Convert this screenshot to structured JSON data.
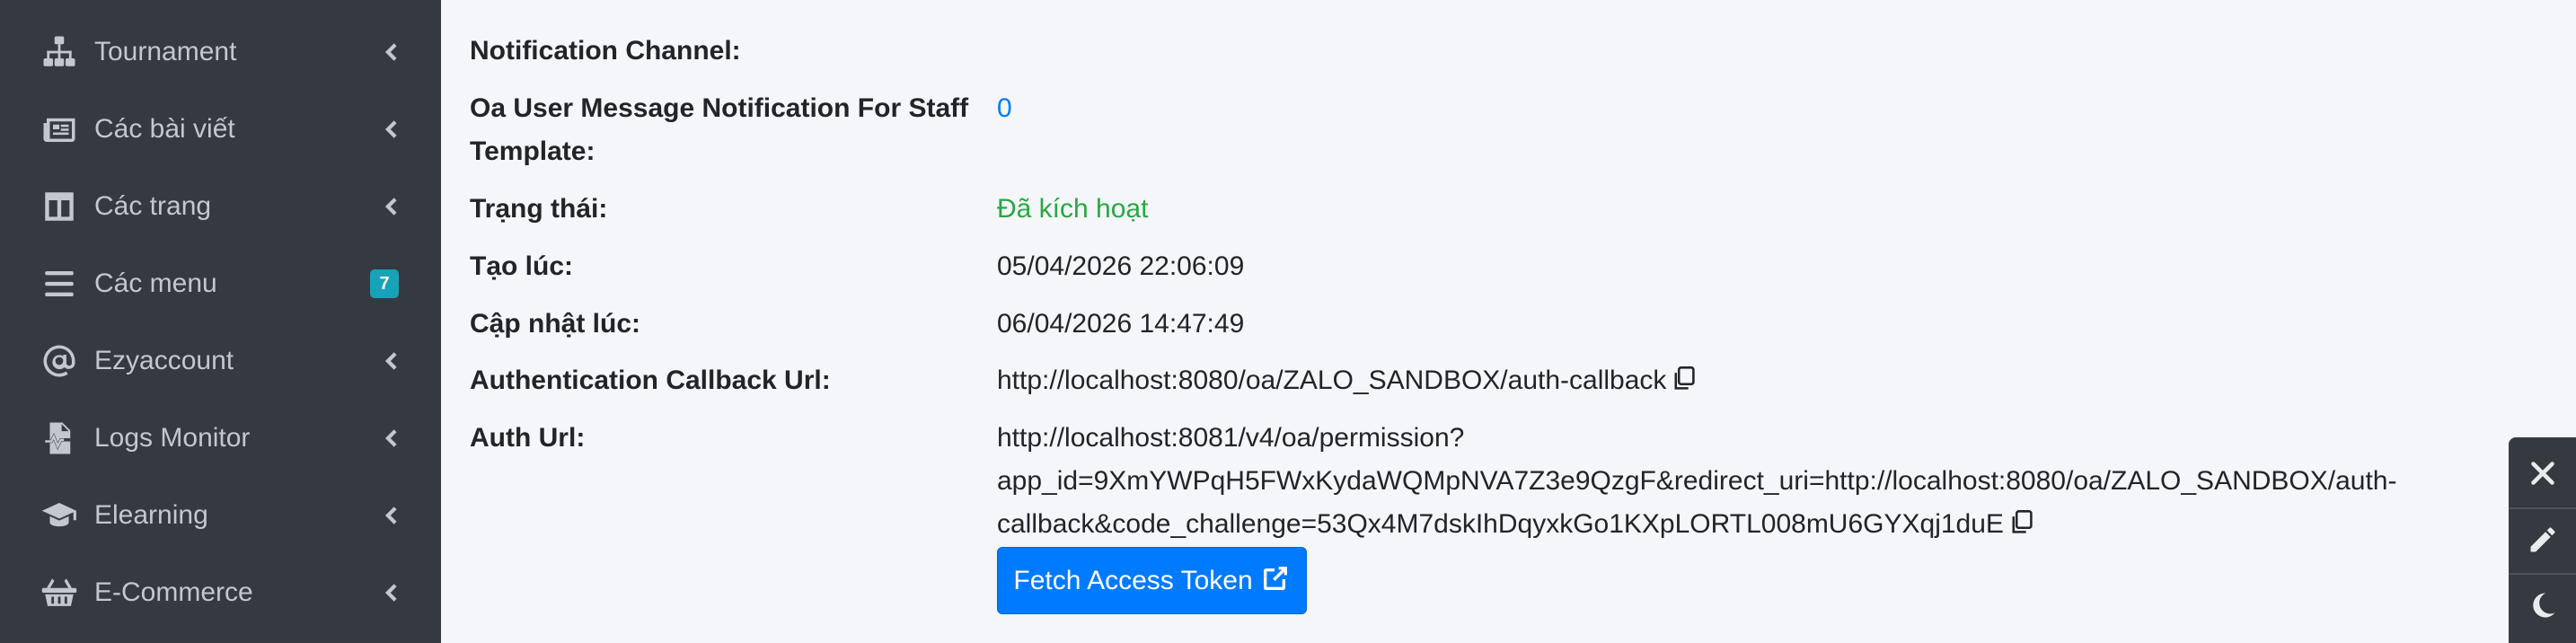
{
  "sidebar": {
    "items": [
      {
        "label": "Tournament",
        "icon": "sitemap-icon"
      },
      {
        "label": "Các bài viết",
        "icon": "newspaper-icon"
      },
      {
        "label": "Các trang",
        "icon": "columns-icon"
      },
      {
        "label": "Các menu",
        "icon": "bars-icon",
        "badge": "7"
      },
      {
        "label": "Ezyaccount",
        "icon": "at-icon"
      },
      {
        "label": "Logs Monitor",
        "icon": "file-medical-alt-icon"
      },
      {
        "label": "Elearning",
        "icon": "graduation-cap-icon"
      },
      {
        "label": "E-Commerce",
        "icon": "shopping-basket-icon"
      }
    ]
  },
  "details": {
    "notification_channel": {
      "label": "Notification Channel:",
      "value": ""
    },
    "oa_template": {
      "label_line1": "Oa User Message Notification For Staff",
      "label_line2": "Template:",
      "value": "0"
    },
    "status": {
      "label": "Trạng thái:",
      "value": "Đã kích hoạt"
    },
    "created_at": {
      "label": "Tạo lúc:",
      "value": "05/04/2026 22:06:09"
    },
    "updated_at": {
      "label": "Cập nhật lúc:",
      "value": "06/04/2026 14:47:49"
    },
    "callback_url": {
      "label": "Authentication Callback Url:",
      "value": "http://localhost:8080/oa/ZALO_SANDBOX/auth-callback"
    },
    "auth_url": {
      "label": "Auth Url:",
      "line1": "http://localhost:8081/v4/oa/permission?",
      "line2": "app_id=9XmYWPqH5FWxKydaWQMpNVA7Z3e9QzgF&redirect_uri=http://localhost:8080/oa/ZALO_SANDBOX/auth-",
      "line3": "callback&code_challenge=53Qx4M7dskIhDqyxkGo1KXpLORTL008mU6GYXqj1duE"
    },
    "fetch_button": "Fetch Access Token"
  },
  "colors": {
    "sidebar_bg": "#343a40",
    "sidebar_text": "#c2c7d0",
    "primary": "#007bff",
    "success": "#28a745",
    "badge": "#17a2b8"
  }
}
